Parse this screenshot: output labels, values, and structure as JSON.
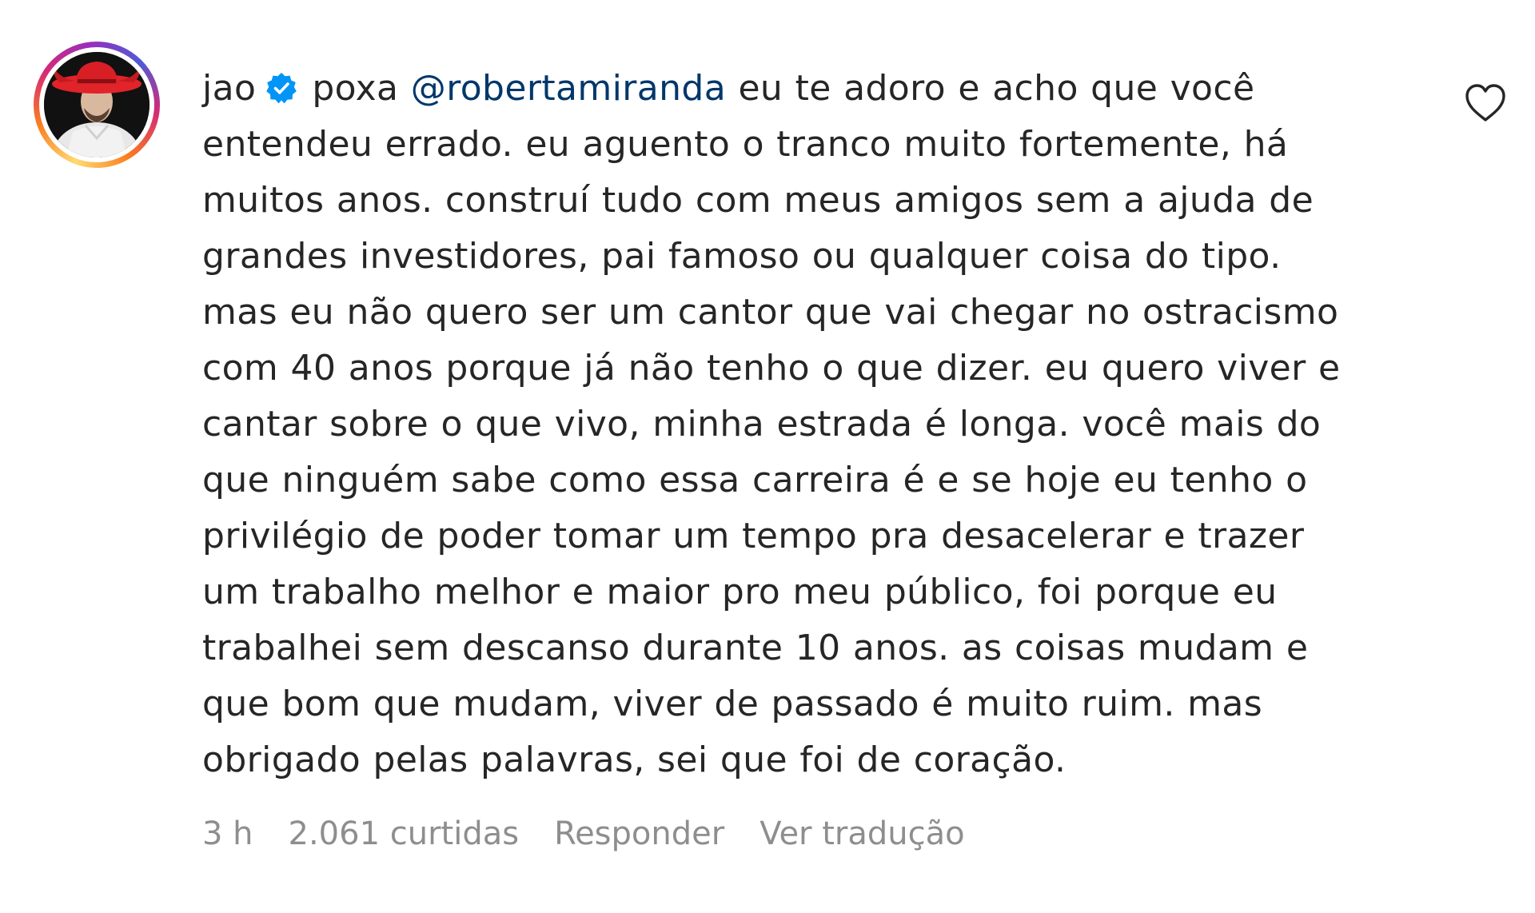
{
  "comment": {
    "username": "jao",
    "verified": true,
    "mention": "@robertamiranda",
    "first_line_before": "poxa ",
    "first_line_after": " eu te adoro e acho que você",
    "lines": [
      "entendeu errado. eu aguento o tranco muito fortemente, há",
      "muitos anos. construí tudo com meus amigos sem a ajuda de",
      "grandes investidores, pai famoso ou qualquer coisa do tipo.",
      "mas eu não quero ser um cantor que vai chegar no ostracismo",
      "com 40 anos porque já não tenho o que dizer. eu quero viver e",
      "cantar sobre o que vivo, minha estrada é longa. você mais do",
      "que ninguém sabe como essa carreira é e se hoje eu tenho o",
      "privilégio de poder tomar um tempo pra desacelerar e trazer",
      "um trabalho melhor e maior pro meu público, foi porque eu",
      "trabalhei sem descanso durante 10 anos. as coisas mudam e",
      "que bom que mudam, viver de passado é muito ruim. mas",
      "obrigado pelas palavras, sei que foi de coração."
    ]
  },
  "meta": {
    "time": "3 h",
    "likes": "2.061 curtidas",
    "reply": "Responder",
    "translate": "Ver tradução"
  },
  "icons": {
    "verified": "verified-badge-icon",
    "like": "heart-outline-icon"
  },
  "colors": {
    "text": "#262626",
    "mention": "#00376b",
    "meta": "#8e8e8e",
    "verified": "#0095f6"
  }
}
